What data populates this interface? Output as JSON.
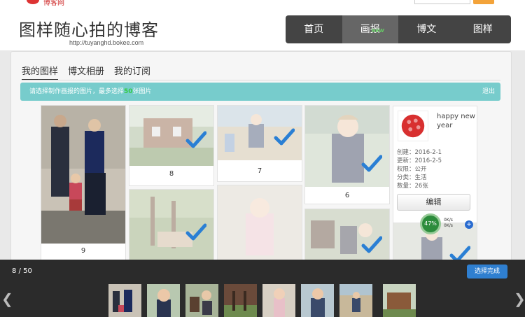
{
  "site": {
    "logo_text": "博客网"
  },
  "blog": {
    "title": "图样随心拍的博客",
    "url": "http://tuyanghd.bokee.com"
  },
  "nav": {
    "items": [
      {
        "label": "首页",
        "active": false
      },
      {
        "label": "画报",
        "active": true,
        "badge": "NEW"
      },
      {
        "label": "博文",
        "active": false
      },
      {
        "label": "图样",
        "active": false
      }
    ]
  },
  "tabs": [
    {
      "label": "我的图样",
      "active": true
    },
    {
      "label": "博文相册",
      "active": false
    },
    {
      "label": "我的订阅",
      "active": false
    }
  ],
  "notice": {
    "prefix": "请选择制作画报的图片，最多选择",
    "max": "50",
    "suffix": "张图片",
    "exit": "退出"
  },
  "photos": [
    {
      "number": "9",
      "selected": false
    },
    {
      "number": "8",
      "selected": true
    },
    {
      "number": "7",
      "selected": true
    },
    {
      "number": "6",
      "selected": true
    }
  ],
  "album": {
    "name": "happy new year",
    "created": "创建：2016-2-1",
    "updated": "更新：2016-2-5",
    "permission": "权限：公开",
    "category": "分类：生活",
    "count": "数量：26张",
    "edit_label": "编辑"
  },
  "speed_widget": {
    "percent": "47%",
    "up": "0K/s",
    "down": "0K/s"
  },
  "bottom": {
    "counter": "8 / 50",
    "done_label": "选择完成"
  },
  "colors": {
    "accent_teal": "#77cccc",
    "nav_bg": "#444444",
    "check_blue": "#2a7fd4",
    "done_blue": "#2f7fd0"
  }
}
